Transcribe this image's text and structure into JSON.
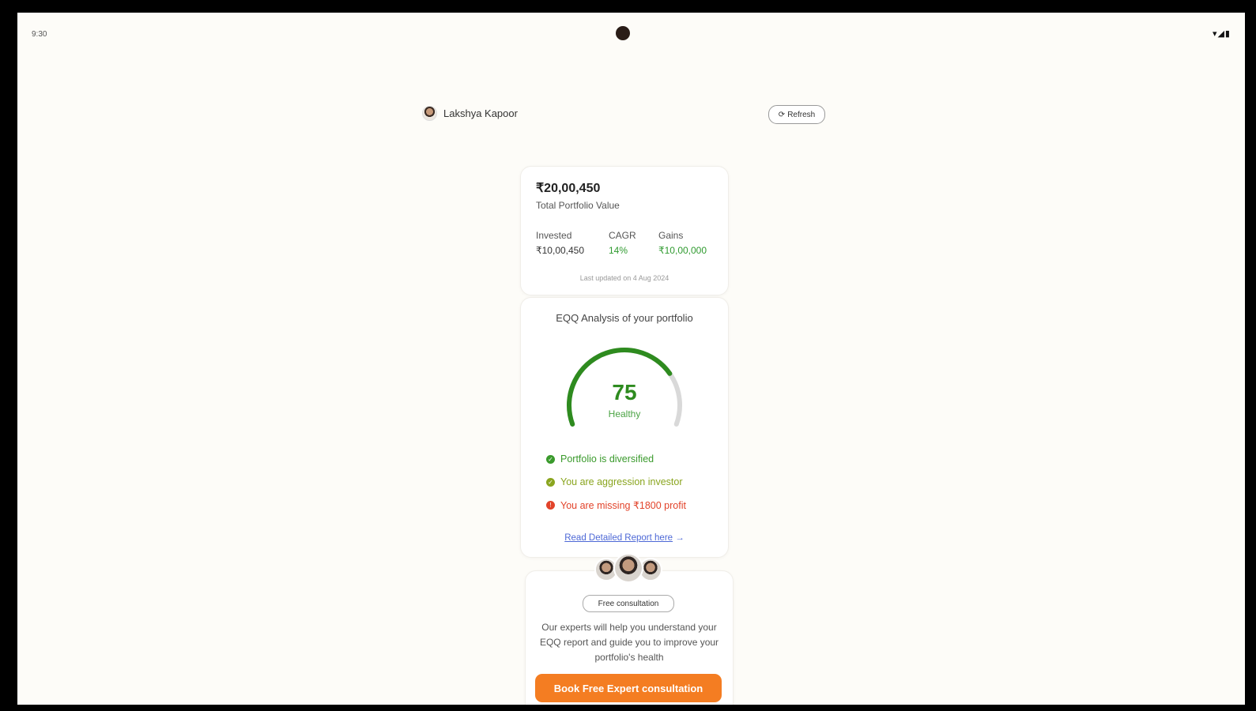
{
  "status_bar": {
    "time": "9:30",
    "icons": "▾◢▮"
  },
  "header": {
    "user_name": "Lakshya Kapoor",
    "refresh_label": "Refresh",
    "refresh_icon": "⟳"
  },
  "portfolio": {
    "value": "₹20,00,450",
    "label": "Total Portfolio Value",
    "invested_label": "Invested",
    "invested_value": "₹10,00,450",
    "cagr_label": "CAGR",
    "cagr_value": "14%",
    "gains_label": "Gains",
    "gains_value": "₹10,00,000",
    "last_updated": "Last updated on 4 Aug 2024"
  },
  "eqq": {
    "title": "EQQ Analysis of your portfolio",
    "score": "75",
    "score_fraction": 0.75,
    "status": "Healthy",
    "checks": [
      {
        "text": "Portfolio is diversified",
        "color": "#3a9a2c",
        "icon": "✓"
      },
      {
        "text": "You are aggression investor",
        "color": "#8aa51f",
        "icon": "✓"
      },
      {
        "text": "You are missing ₹1800 profit",
        "color": "#e2432a",
        "icon": "!"
      }
    ],
    "report_link": "Read Detailed Report here",
    "report_arrow": "→"
  },
  "consultation": {
    "pill": "Free consultation",
    "text": "Our experts will help you understand your EQQ report and guide you to improve your portfolio's health",
    "cta": "Book Free Expert consultation"
  },
  "colors": {
    "accent": "#f47d22",
    "gauge": "#2e8b1f",
    "gauge_track": "#d9d9d9",
    "link": "#4d68d6"
  }
}
